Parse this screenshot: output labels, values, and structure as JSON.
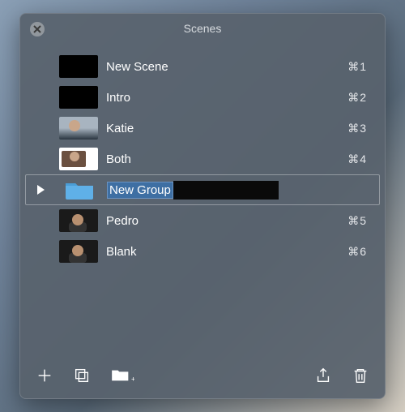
{
  "panel": {
    "title": "Scenes"
  },
  "scenes": [
    {
      "label": "New Scene",
      "shortcut": "⌘1",
      "thumb": "black"
    },
    {
      "label": "Intro",
      "shortcut": "⌘2",
      "thumb": "black"
    },
    {
      "label": "Katie",
      "shortcut": "⌘3",
      "thumb": "katie"
    },
    {
      "label": "Both",
      "shortcut": "⌘4",
      "thumb": "both"
    }
  ],
  "editingGroup": {
    "label": "New Group"
  },
  "scenesAfter": [
    {
      "label": "Pedro",
      "shortcut": "⌘5",
      "thumb": "pedro"
    },
    {
      "label": "Blank",
      "shortcut": "⌘6",
      "thumb": "blank"
    }
  ],
  "toolbar": {
    "add": "add-button",
    "duplicate": "duplicate-button",
    "newFolder": "new-folder-button",
    "share": "share-button",
    "delete": "delete-button"
  }
}
